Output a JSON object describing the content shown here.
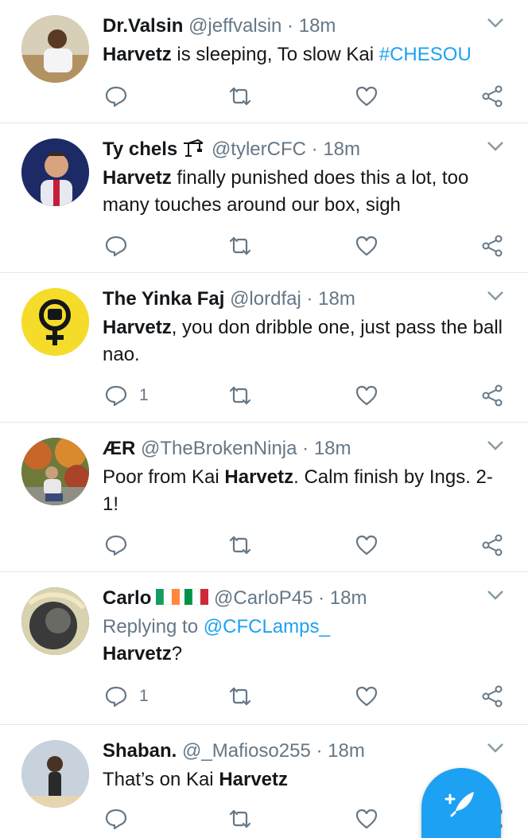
{
  "tweets": [
    {
      "name": "Dr.Valsin",
      "handle": "@jeffvalsin",
      "dot": "·",
      "time": "18m",
      "body": [
        {
          "t": "Harvetz",
          "b": true
        },
        {
          "t": " is sleeping, To slow Kai "
        },
        {
          "t": "#CHESOU",
          "tag": true
        }
      ],
      "reply_count": "",
      "avatar_color": "#c9b48a"
    },
    {
      "name": "Ty chels",
      "handle": "@tylerCFC",
      "dot": "·",
      "time": "18m",
      "emoji": "🏗",
      "body": [
        {
          "t": "Harvetz",
          "b": true
        },
        {
          "t": " finally punished does this a lot, too many touches around our box, sigh"
        }
      ],
      "reply_count": "",
      "avatar_color": "#2b3f8c"
    },
    {
      "name": "The Yinka Faj",
      "handle": "@lordfaj",
      "dot": "·",
      "time": "18m",
      "body": [
        {
          "t": "Harvetz",
          "b": true
        },
        {
          "t": ", you don dribble one, just pass the ball nao."
        }
      ],
      "reply_count": "1",
      "avatar_color": "#f5dc2a"
    },
    {
      "name": "ÆR",
      "handle": "@TheBrokenNinja",
      "dot": "·",
      "time": "18m",
      "body": [
        {
          "t": "Poor from Kai "
        },
        {
          "t": "Harvetz",
          "b": true
        },
        {
          "t": ". Calm finish by Ings. 2-1!"
        }
      ],
      "reply_count": "",
      "avatar_color": "#8a6a3a"
    },
    {
      "name": "Carlo",
      "handle": "@CarloP45",
      "dot": "·",
      "time": "18m",
      "flags": true,
      "replying": "Replying to ",
      "replying_to": "@CFCLamps_",
      "body": [
        {
          "t": "Harvetz",
          "b": true
        },
        {
          "t": "?"
        }
      ],
      "reply_count": "1",
      "avatar_color": "#4a4a4a"
    },
    {
      "name": "Shaban.",
      "handle": "@_Mafioso255",
      "dot": "·",
      "time": "18m",
      "body": [
        {
          "t": "That’s on Kai "
        },
        {
          "t": "Harvetz",
          "b": true
        }
      ],
      "reply_count": "",
      "avatar_color": "#b9c6d6"
    }
  ],
  "compose_button": "compose-tweet"
}
